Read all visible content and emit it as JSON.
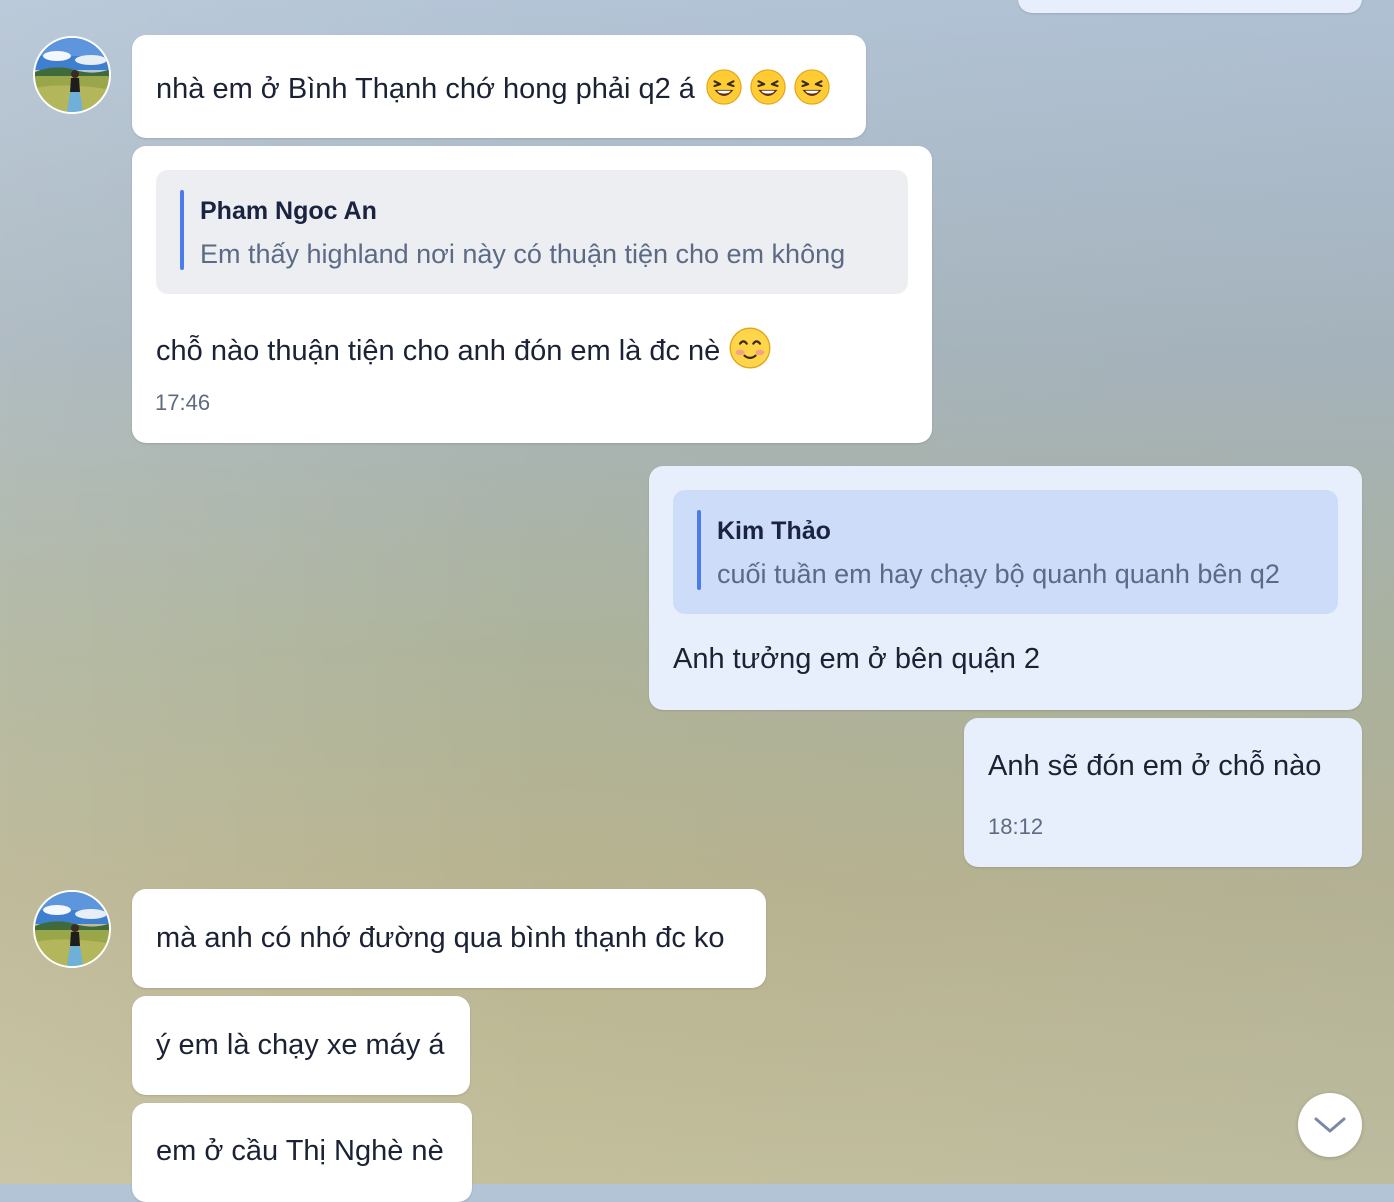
{
  "messages": {
    "m1": {
      "text": "nhà em ở Bình Thạnh chớ hong phải q2 á",
      "emoji": "laughing-face"
    },
    "m2": {
      "quote_name": "Pham Ngoc An",
      "quote_text": "Em thấy highland nơi này có thuận tiện cho em không",
      "text": "chỗ nào thuận tiện cho anh đón em là đc nè",
      "emoji": "smiling-blush-face",
      "time": "17:46"
    },
    "m3": {
      "quote_name": "Kim Thảo",
      "quote_text": "cuối tuần em hay chạy bộ quanh quanh bên q2",
      "text": "Anh tưởng em ở bên quận 2"
    },
    "m4": {
      "text": "Anh sẽ đón em ở chỗ nào",
      "time": "18:12"
    },
    "m5": {
      "text": "mà anh có nhớ đường qua bình thạnh đc ko"
    },
    "m6": {
      "text": "ý em là chạy xe máy á"
    },
    "m7": {
      "text": "em ở cầu Thị Nghè nè"
    }
  },
  "icons": {
    "scroll_down": "chevron-down-icon",
    "avatar": "contact-avatar"
  },
  "colors": {
    "incoming_bubble": "#ffffff",
    "outgoing_bubble": "#e7eefc",
    "outgoing_quote": "#cddcf8",
    "incoming_quote": "#eceef2",
    "quote_bar": "#4b7bec",
    "time_text": "#5f6b80"
  }
}
